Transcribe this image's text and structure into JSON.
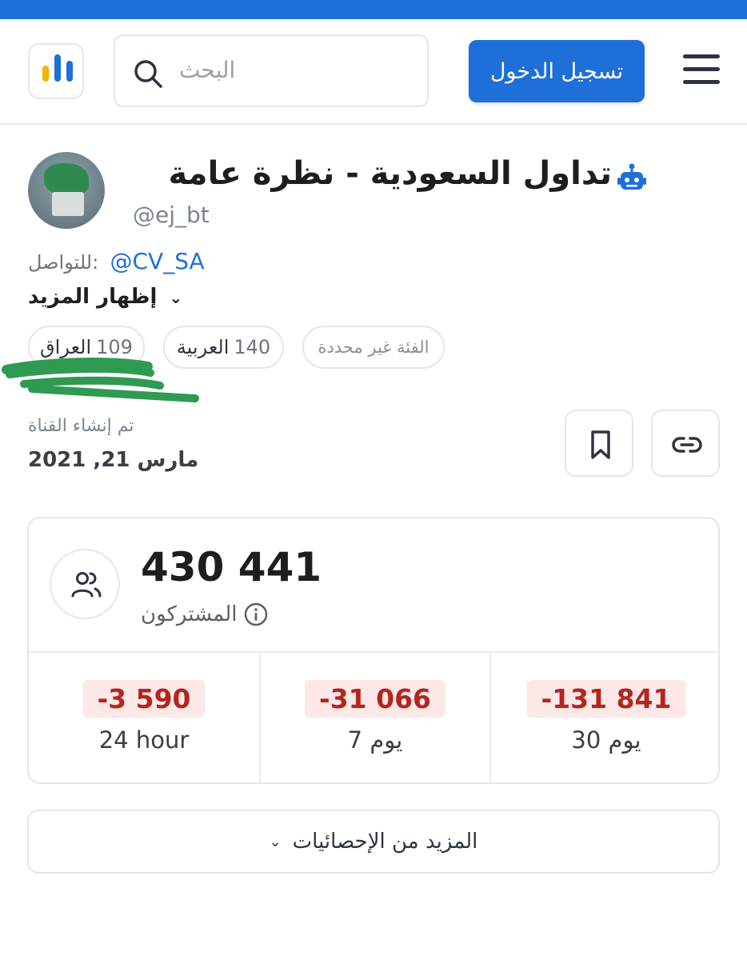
{
  "header": {
    "search_placeholder": "البحث",
    "login_label": "تسجيل الدخول"
  },
  "channel": {
    "title": "تداول السعودية - نظرة عامة",
    "handle": "@ej_bt",
    "contact_label": "للتواصل:",
    "contact_link": "@CV_SA",
    "show_more": "إظهار المزيد",
    "chips": [
      {
        "num": "109",
        "label": "العراق"
      },
      {
        "num": "140",
        "label": "العربية"
      },
      {
        "label": "الفئة غير محددة"
      }
    ],
    "created_label": "تم إنشاء القناة",
    "created_date": "مارس 21, 2021"
  },
  "stats": {
    "subscribers": "430 441",
    "subscribers_label": "المشتركون",
    "changes": [
      {
        "value": "-3 590",
        "period": "24 hour"
      },
      {
        "value": "-31 066",
        "period": "7 يوم"
      },
      {
        "value": "-131 841",
        "period": "30 يوم"
      }
    ],
    "more_stats": "المزيد من الإحصائيات"
  },
  "colors": {
    "brand_blue": "#1f6fd8",
    "negative_red": "#b3261e",
    "negative_bg": "#fde8e8",
    "scribble_green": "#2e9a52"
  },
  "icons": [
    "menu-icon",
    "search-icon",
    "logo-icon",
    "bot-icon",
    "bookmark-icon",
    "link-icon",
    "users-icon",
    "info-icon",
    "chevron-down-icon"
  ]
}
